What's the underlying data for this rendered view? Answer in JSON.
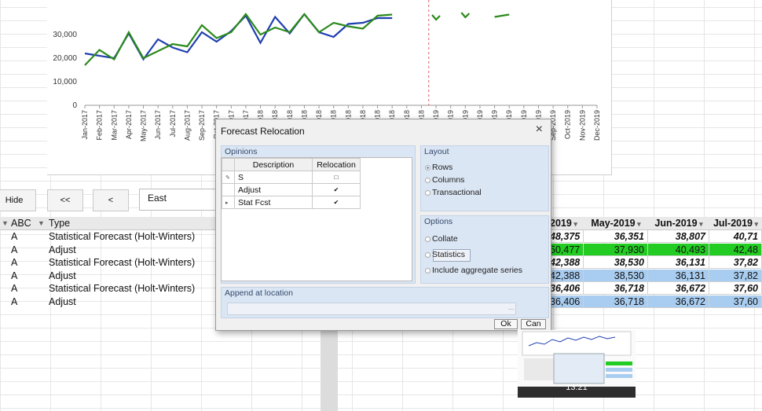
{
  "chart": {
    "y_ticks": [
      "30,000",
      "20,000",
      "10,000",
      "0"
    ],
    "x_labels": [
      "Jan-2017",
      "Feb-2017",
      "Mar-2017",
      "Apr-2017",
      "May-2017",
      "Jun-2017",
      "Jul-2017",
      "Aug-2017",
      "Sep-2017",
      "Oct-2017",
      "Nov-2017",
      "Dec-2017",
      "Jan-2018",
      "Feb-2018",
      "Mar-2018",
      "Apr-2018",
      "May-2018",
      "Jun-2018",
      "Jul-2018",
      "Aug-2018",
      "Sep-2018",
      "Oct-2018",
      "Nov-2018",
      "Dec-2018",
      "Jan-2019",
      "Feb-2019",
      "Mar-2019",
      "Apr-2019",
      "May-2019",
      "Jun-2019",
      "Jul-2019",
      "Aug-2019",
      "Sep-2019",
      "Oct-2019",
      "Nov-2019",
      "Dec-2019"
    ],
    "colors": {
      "blue_series": "#1f3fb0",
      "green_series": "#2c8a1c",
      "divider": "#e06060"
    }
  },
  "chart_data": {
    "type": "line",
    "x": [
      "Jan-2017",
      "Feb-2017",
      "Mar-2017",
      "Apr-2017",
      "May-2017",
      "Jun-2017",
      "Jul-2017",
      "Aug-2017",
      "Sep-2017",
      "Oct-2017",
      "Nov-2017",
      "Dec-2017",
      "Jan-2018",
      "Feb-2018",
      "Mar-2018",
      "Apr-2018",
      "May-2018",
      "Jun-2018",
      "Jul-2018",
      "Aug-2018",
      "Sep-2018",
      "Oct-2018",
      "Nov-2018",
      "Dec-2018",
      "Jan-2019",
      "Feb-2019",
      "Mar-2019",
      "Apr-2019",
      "May-2019",
      "Jun-2019",
      "Jul-2019",
      "Aug-2019",
      "Sep-2019",
      "Oct-2019",
      "Nov-2019",
      "Dec-2019"
    ],
    "series": [
      {
        "values": [
          22000,
          21000,
          20000,
          30500,
          19500,
          28000,
          24500,
          22500,
          31000,
          27000,
          31500,
          38000,
          26500,
          37500,
          30500,
          44000,
          31000,
          29000,
          34500,
          35000,
          37000,
          37000,
          null,
          null,
          null,
          null,
          null,
          null,
          null,
          null,
          null,
          null,
          null,
          null,
          null,
          null
        ]
      },
      {
        "values": [
          17000,
          23500,
          19500,
          31000,
          20000,
          23000,
          26000,
          25000,
          34000,
          28500,
          31000,
          39000,
          30000,
          33000,
          31000,
          42000,
          31000,
          35000,
          33500,
          32500,
          38000,
          38500,
          null,
          null,
          37000,
          null,
          38000,
          null,
          37500,
          38500,
          null,
          null,
          null,
          null,
          null,
          null
        ]
      }
    ],
    "ylim": [
      0,
      38000
    ],
    "ytick_values": [
      0,
      10000,
      20000,
      30000
    ],
    "divider_after": "Dec-2018"
  },
  "toolbar": {
    "hide": "Hide",
    "first": "<<",
    "prev": "<",
    "region": "East"
  },
  "left_table": {
    "headers": {
      "abc": "ABC",
      "type": "Type"
    },
    "rows": [
      {
        "abc": "A",
        "type": "Statistical Forecast (Holt-Winters)"
      },
      {
        "abc": "A",
        "type": "Adjust"
      },
      {
        "abc": "A",
        "type": "Statistical Forecast (Holt-Winters)"
      },
      {
        "abc": "A",
        "type": "Adjust"
      },
      {
        "abc": "A",
        "type": "Statistical Forecast (Holt-Winters)"
      },
      {
        "abc": "A",
        "type": "Adjust"
      }
    ]
  },
  "right_table": {
    "headers": [
      "2019",
      "May-2019",
      "Jun-2019",
      "Jul-2019"
    ],
    "rows": [
      {
        "style": "bi",
        "values": [
          "48,375",
          "36,351",
          "38,807",
          "40,71"
        ]
      },
      {
        "style": "green",
        "values": [
          "50,477",
          "37,930",
          "40,493",
          "42,48"
        ]
      },
      {
        "style": "bi",
        "values": [
          "42,388",
          "38,530",
          "36,131",
          "37,82"
        ]
      },
      {
        "style": "blue",
        "values": [
          "42,388",
          "38,530",
          "36,131",
          "37,82"
        ]
      },
      {
        "style": "bi",
        "values": [
          "36,406",
          "36,718",
          "36,672",
          "37,60"
        ]
      },
      {
        "style": "blue",
        "values": [
          "36,406",
          "36,718",
          "36,672",
          "37,60"
        ]
      }
    ]
  },
  "dialog": {
    "title": "Forecast Relocation",
    "close": "×",
    "opinions_label": "Opinions",
    "grid_headers": {
      "description": "Description",
      "relocation": "Relocation"
    },
    "grid_rows": [
      {
        "description": "S",
        "relocation": "□"
      },
      {
        "description": "Adjust",
        "relocation": "✔"
      },
      {
        "description": "Stat Fcst",
        "relocation": "✔"
      }
    ],
    "layout_label": "Layout",
    "layout_options": [
      "Rows",
      "Columns",
      "Transactional"
    ],
    "options_label": "Options",
    "option_items": [
      "Collate",
      "Statistics",
      "Include aggregate series"
    ],
    "append_label": "Append at location",
    "append_ellipsis": "...",
    "ok": "Ok",
    "cancel": "Can"
  },
  "thumbnail": {
    "time": "13:21"
  }
}
